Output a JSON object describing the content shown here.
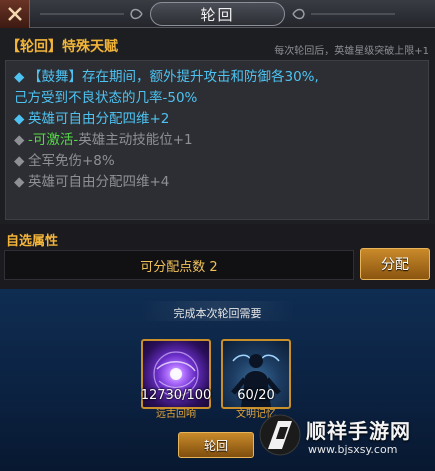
{
  "window": {
    "title": "轮回"
  },
  "talent": {
    "title": "【轮回】特殊天赋",
    "hint": "每次轮回后，英雄星级突破上限+1",
    "lines": [
      {
        "bullet": "◆",
        "text": "【鼓舞】存在期间，额外提升攻击和防御各30%,"
      },
      {
        "bullet": "",
        "text": "己方受到不良状态的几率-50%"
      },
      {
        "bullet": "◆",
        "text": "英雄可自由分配四维+2"
      },
      {
        "bullet": "◆",
        "prefix": "-可激活-",
        "text": "英雄主动技能位+1"
      },
      {
        "bullet": "◆",
        "text": "全军免伤+8%"
      },
      {
        "bullet": "◆",
        "text": "英雄可自由分配四维+4"
      }
    ]
  },
  "attributes": {
    "label": "自选属性",
    "points_text": "可分配点数 2",
    "assign_button": "分配"
  },
  "requirements": {
    "title": "完成本次轮回需要",
    "items": [
      {
        "name": "远古回响",
        "count": "12730/100",
        "icon": "purple-orb-icon"
      },
      {
        "name": "文明记忆",
        "count": "60/20",
        "icon": "silhouette-figure-icon"
      }
    ],
    "reincarnate_button": "轮回"
  },
  "watermark": {
    "name": "顺祥手游网",
    "url": "www.bjsxsy.com"
  },
  "colors": {
    "gold": "#f2b53a",
    "cyan": "#4ec3f2",
    "green": "#57d84a",
    "gray": "#8e9096",
    "panel_blue": "#0b2140"
  }
}
